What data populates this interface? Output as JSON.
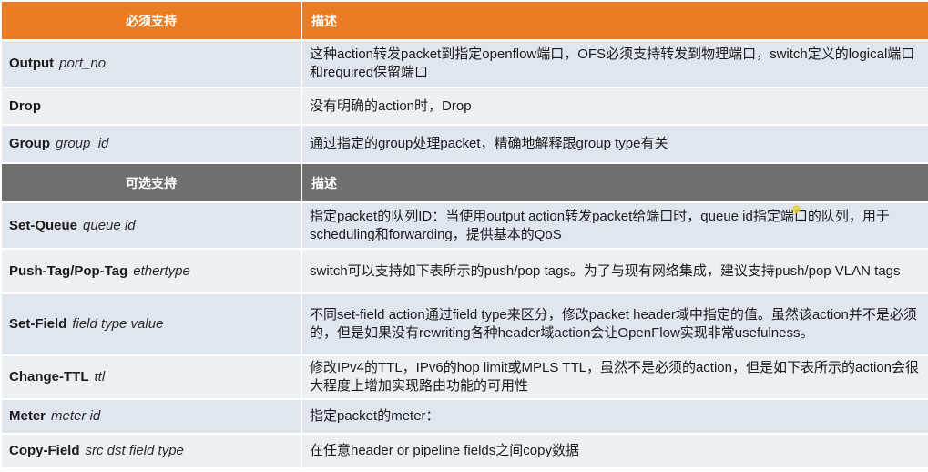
{
  "required": {
    "header_name": "必须支持",
    "header_desc": "描述",
    "rows": [
      {
        "name": "Output",
        "param": "port_no",
        "desc": "这种action转发packet到指定openflow端口，OFS必须支持转发到物理端口，switch定义的logical端口和required保留端口"
      },
      {
        "name": "Drop",
        "param": "",
        "desc": "没有明确的action时，Drop"
      },
      {
        "name": "Group",
        "param": "group_id",
        "desc": "通过指定的group处理packet，精确地解释跟group type有关"
      }
    ]
  },
  "optional": {
    "header_name": "可选支持",
    "header_desc": "描述",
    "rows": [
      {
        "name": "Set-Queue",
        "param": "queue id",
        "desc": "指定packet的队列ID：当使用output action转发packet给端口时，queue id指定端口的队列，用于scheduling和forwarding，提供基本的QoS"
      },
      {
        "name": "Push-Tag/Pop-Tag",
        "param": "ethertype",
        "desc": "switch可以支持如下表所示的push/pop tags。为了与现有网络集成，建议支持push/pop VLAN tags"
      },
      {
        "name": "Set-Field",
        "param": "field type value",
        "desc": "不同set-field action通过field type来区分，修改packet header域中指定的值。虽然该action并不是必须的，但是如果没有rewriting各种header域action会让OpenFlow实现非常usefulness。"
      },
      {
        "name": "Change-TTL",
        "param": "ttl",
        "desc": "修改IPv4的TTL，IPv6的hop limit或MPLS TTL，虽然不是必须的action，但是如下表所示的action会很大程度上增加实现路由功能的可用性"
      },
      {
        "name": "Meter",
        "param": "meter id",
        "desc": "指定packet的meter："
      },
      {
        "name": "Copy-Field",
        "param": "src dst field type",
        "desc": "在任意header or pipeline fields之间copy数据"
      }
    ]
  },
  "colors": {
    "required_header": "#ea7c23",
    "optional_header": "#6f6f6f",
    "row_fill": "#dfe6ee",
    "row_fill_alt": "#ecf0f5"
  }
}
